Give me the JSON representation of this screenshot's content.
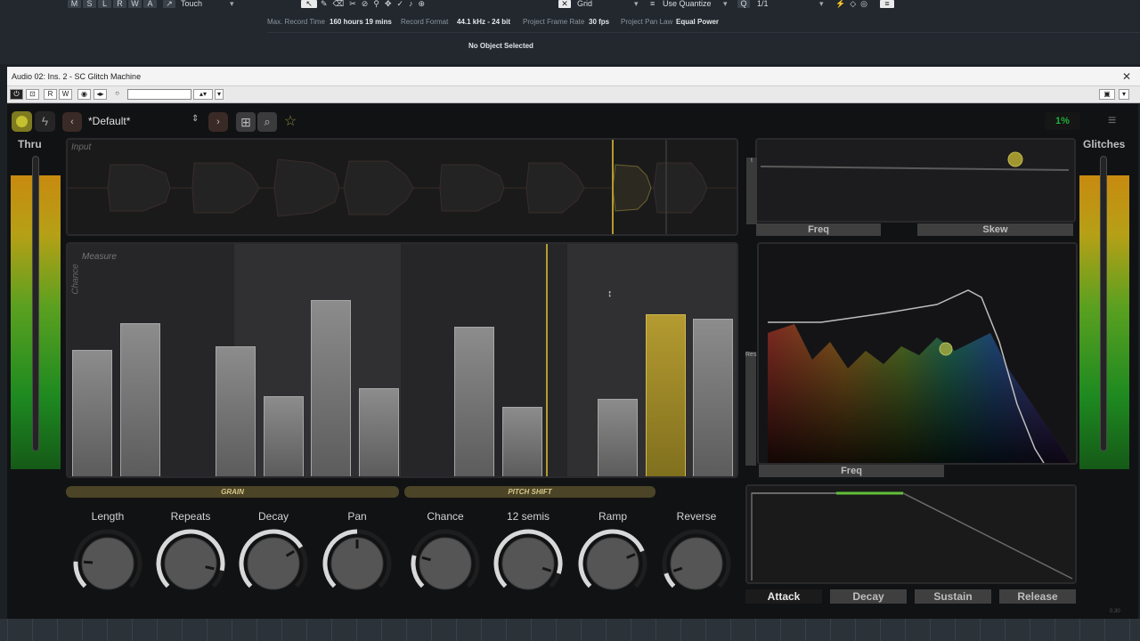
{
  "daw": {
    "track_buttons": [
      "M",
      "S",
      "L",
      "R",
      "W",
      "A"
    ],
    "automation_mode": "Touch",
    "snap_type": "Grid",
    "quantize_mode": "Use Quantize",
    "quantize_value": "1/1",
    "info": [
      {
        "label": "Max. Record Time",
        "value": "160 hours 19 mins"
      },
      {
        "label": "Record Format",
        "value": "44.1 kHz - 24 bit"
      },
      {
        "label": "Project Frame Rate",
        "value": "30 fps"
      },
      {
        "label": "Project Pan Law",
        "value": "Equal Power"
      }
    ],
    "status": "No Object Selected"
  },
  "window": {
    "title": "Audio 02: Ins. 2 - SC Glitch Machine",
    "toolbar_buttons": [
      "R",
      "W"
    ]
  },
  "plugin": {
    "preset_name": "*Default*",
    "percent": "1%",
    "thru_label": "Thru",
    "glitches_label": "Glitches",
    "input_label": "Input",
    "measure_label": "Measure",
    "chance_axis_label": "Chance",
    "freq_label": "Freq",
    "skew_label": "Skew",
    "filter_freq_label": "Freq",
    "res_label": "Res",
    "t_label": "t",
    "sections": {
      "grain": "GRAIN",
      "pitch_shift": "PITCH SHIFT"
    },
    "knobs": [
      {
        "label": "Length",
        "value": 0.18
      },
      {
        "label": "Repeats",
        "value": 0.88
      },
      {
        "label": "Decay",
        "value": 0.72
      },
      {
        "label": "Pan",
        "value": 0.5
      },
      {
        "label": "Chance",
        "value": 0.22
      },
      {
        "label": "12 semis",
        "value": 0.9
      },
      {
        "label": "Ramp",
        "value": 0.75
      },
      {
        "label": "Reverse",
        "value": 0.1
      }
    ],
    "envelope_tabs": [
      {
        "label": "Attack",
        "active": true
      },
      {
        "label": "Decay",
        "active": false
      },
      {
        "label": "Sustain",
        "active": false
      },
      {
        "label": "Release",
        "active": false
      }
    ],
    "chance_bars": [
      0.6,
      0.73,
      0,
      0.62,
      0.38,
      0.84,
      0.42,
      0,
      0.71,
      0.33,
      0,
      0.37,
      0.77,
      0.75
    ],
    "selected_bar": 12,
    "version": "0.30",
    "colors": {
      "accent": "#b49a30",
      "meter_green": "#1e8a20",
      "meter_orange": "#c88a10",
      "percent_green": "#1fae3a"
    }
  }
}
